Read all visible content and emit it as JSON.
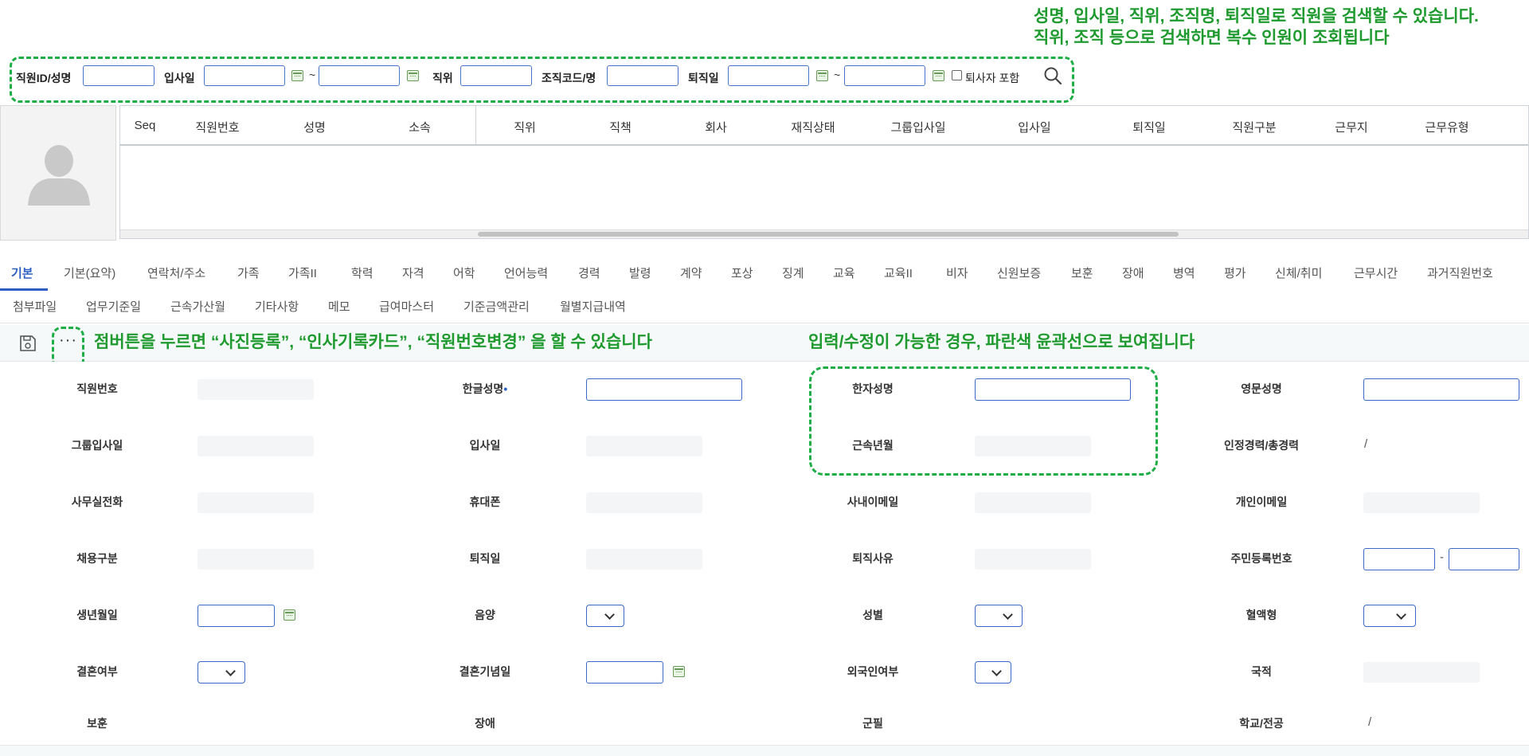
{
  "annotations": {
    "search_line1": "성명, 입사일, 직위, 조직명, 퇴직일로 직원을 검색할 수 있습니다.",
    "search_line2": "직위, 조직 등으로 검색하면 복수 인원이 조회됩니다",
    "dots_hint": "점버튼을 누르면 “사진등록”, “인사기록카드”, “직원번호변경” 을 할 수 있습니다",
    "edit_hint": "입력/수정이 가능한 경우, 파란색 윤곽선으로 보여집니다",
    "color": "#1f9a2f"
  },
  "search": {
    "employee_label": "직원ID/성명",
    "hire_date_label": "입사일",
    "position_label": "직위",
    "org_label": "조직코드/명",
    "retire_date_label": "퇴직일",
    "tilde": "~",
    "include_retired_label": "퇴사자 포함",
    "include_retired_checked": false
  },
  "grid": {
    "columns": [
      "Seq",
      "직원번호",
      "성명",
      "소속",
      "직위",
      "직책",
      "회사",
      "재직상태",
      "그룹입사일",
      "입사일",
      "퇴직일",
      "직원구분",
      "근무지",
      "근무유형"
    ],
    "rows": []
  },
  "tabs": {
    "row1": [
      "기본",
      "기본(요약)",
      "연락처/주소",
      "가족",
      "가족II",
      "학력",
      "자격",
      "어학",
      "언어능력",
      "경력",
      "발령",
      "계약",
      "포상",
      "징계",
      "교육",
      "교육II",
      "비자",
      "신원보증",
      "보훈",
      "장애",
      "병역",
      "평가",
      "신체/취미",
      "근무시간",
      "과거직원번호"
    ],
    "row2": [
      "첨부파일",
      "업무기준일",
      "근속가산월",
      "기타사항",
      "메모",
      "급여마스터",
      "기준금액관리",
      "월별지급내역"
    ],
    "active": "기본"
  },
  "toolbar": {
    "dots": "···"
  },
  "form": {
    "emp_no": "직원번호",
    "kor_name": "한글성명",
    "required_mark": "•",
    "hanja_name": "한자성명",
    "eng_name": "영문성명",
    "group_hire_date": "그룹입사일",
    "hire_date": "입사일",
    "service_period": "근속년월",
    "career": "인정경력/총경력",
    "career_value": "/",
    "office_phone": "사무실전화",
    "mobile": "휴대폰",
    "company_email": "사내이메일",
    "personal_email": "개인이메일",
    "employment_type": "채용구분",
    "retire_date": "퇴직일",
    "retire_reason": "퇴직사유",
    "rrn": "주민등록번호",
    "rrn_sep": "-",
    "birth_date": "생년월일",
    "lunar_solar": "음양",
    "gender": "성별",
    "blood_type": "혈액형",
    "marital": "결혼여부",
    "wedding_date": "결혼기념일",
    "foreigner": "외국인여부",
    "nationality": "국적",
    "veteran": "보훈",
    "disability": "장애",
    "military": "군필",
    "school_major": "학교/전공",
    "school_value": "/"
  }
}
